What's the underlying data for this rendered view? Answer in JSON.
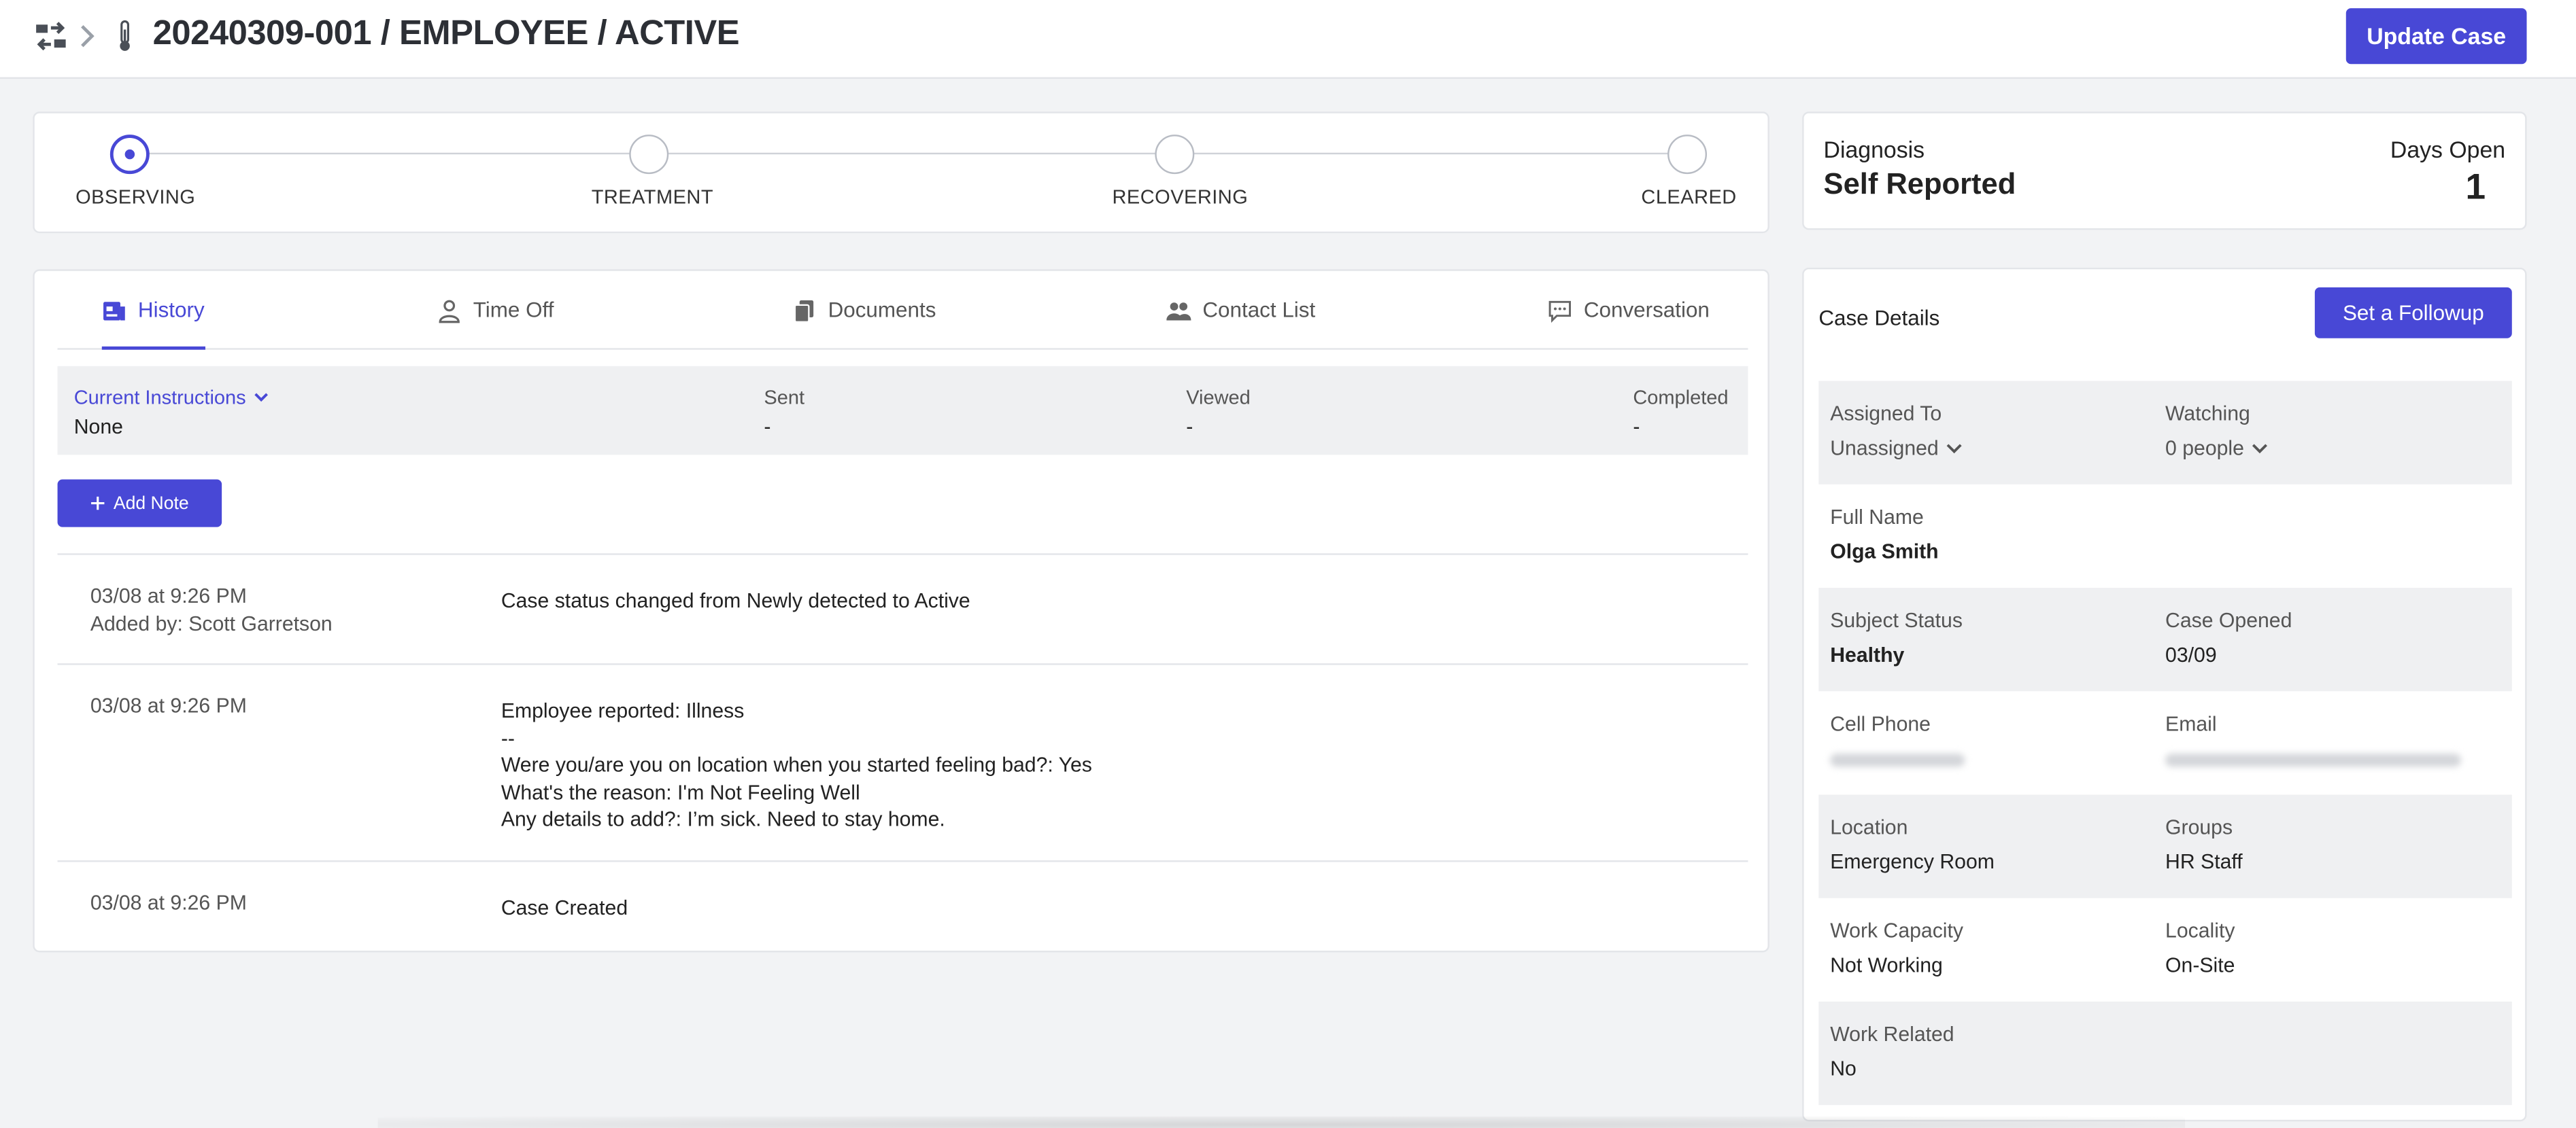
{
  "header": {
    "title": "20240309-001 / EMPLOYEE / ACTIVE",
    "update_button": "Update Case",
    "icons": [
      "swap-icon",
      "chevron-right-icon",
      "thermometer-icon"
    ]
  },
  "progress": {
    "steps": [
      {
        "label": "OBSERVING",
        "active": true
      },
      {
        "label": "TREATMENT",
        "active": false
      },
      {
        "label": "RECOVERING",
        "active": false
      },
      {
        "label": "CLEARED",
        "active": false
      }
    ]
  },
  "diagnosis": {
    "label": "Diagnosis",
    "value": "Self Reported",
    "days_label": "Days Open",
    "days_value": "1"
  },
  "tabs": [
    {
      "label": "History",
      "icon": "history-icon",
      "active": true
    },
    {
      "label": "Time Off",
      "icon": "person-icon",
      "active": false
    },
    {
      "label": "Documents",
      "icon": "documents-icon",
      "active": false
    },
    {
      "label": "Contact List",
      "icon": "people-icon",
      "active": false
    },
    {
      "label": "Conversation",
      "icon": "chat-icon",
      "active": false
    }
  ],
  "instructions": {
    "current_label": "Current Instructions",
    "current_value": "None",
    "sent_label": "Sent",
    "sent_value": "-",
    "viewed_label": "Viewed",
    "viewed_value": "-",
    "completed_label": "Completed",
    "completed_value": "-"
  },
  "add_note": "Add Note",
  "history": [
    {
      "time": "03/08 at 9:26 PM",
      "added_by": "Added by: Scott Garretson",
      "message": "Case status changed from Newly detected to Active"
    },
    {
      "time": "03/08 at 9:26 PM",
      "added_by": "",
      "message": "Employee reported: Illness\n--\nWere you/are you on location when you started feeling bad?: Yes\nWhat's the reason: I'm Not Feeling Well\nAny details to add?: I’m sick. Need to stay home."
    },
    {
      "time": "03/08 at 9:26 PM",
      "added_by": "",
      "message": "Case Created"
    }
  ],
  "details": {
    "title": "Case Details",
    "followup_button": "Set a Followup",
    "assigned_to_label": "Assigned To",
    "assigned_to_value": "Unassigned",
    "watching_label": "Watching",
    "watching_value": "0 people",
    "full_name_label": "Full Name",
    "full_name_value": "Olga Smith",
    "subject_status_label": "Subject Status",
    "subject_status_value": "Healthy",
    "case_opened_label": "Case Opened",
    "case_opened_value": "03/09",
    "cell_phone_label": "Cell Phone",
    "email_label": "Email",
    "location_label": "Location",
    "location_value": "Emergency Room",
    "groups_label": "Groups",
    "groups_value": "HR Staff",
    "work_capacity_label": "Work Capacity",
    "work_capacity_value": "Not Working",
    "locality_label": "Locality",
    "locality_value": "On-Site",
    "work_related_label": "Work Related",
    "work_related_value": "No"
  },
  "colors": {
    "accent": "#4848d6",
    "background": "#f2f3f5",
    "shaded_row": "#eff0f2"
  }
}
